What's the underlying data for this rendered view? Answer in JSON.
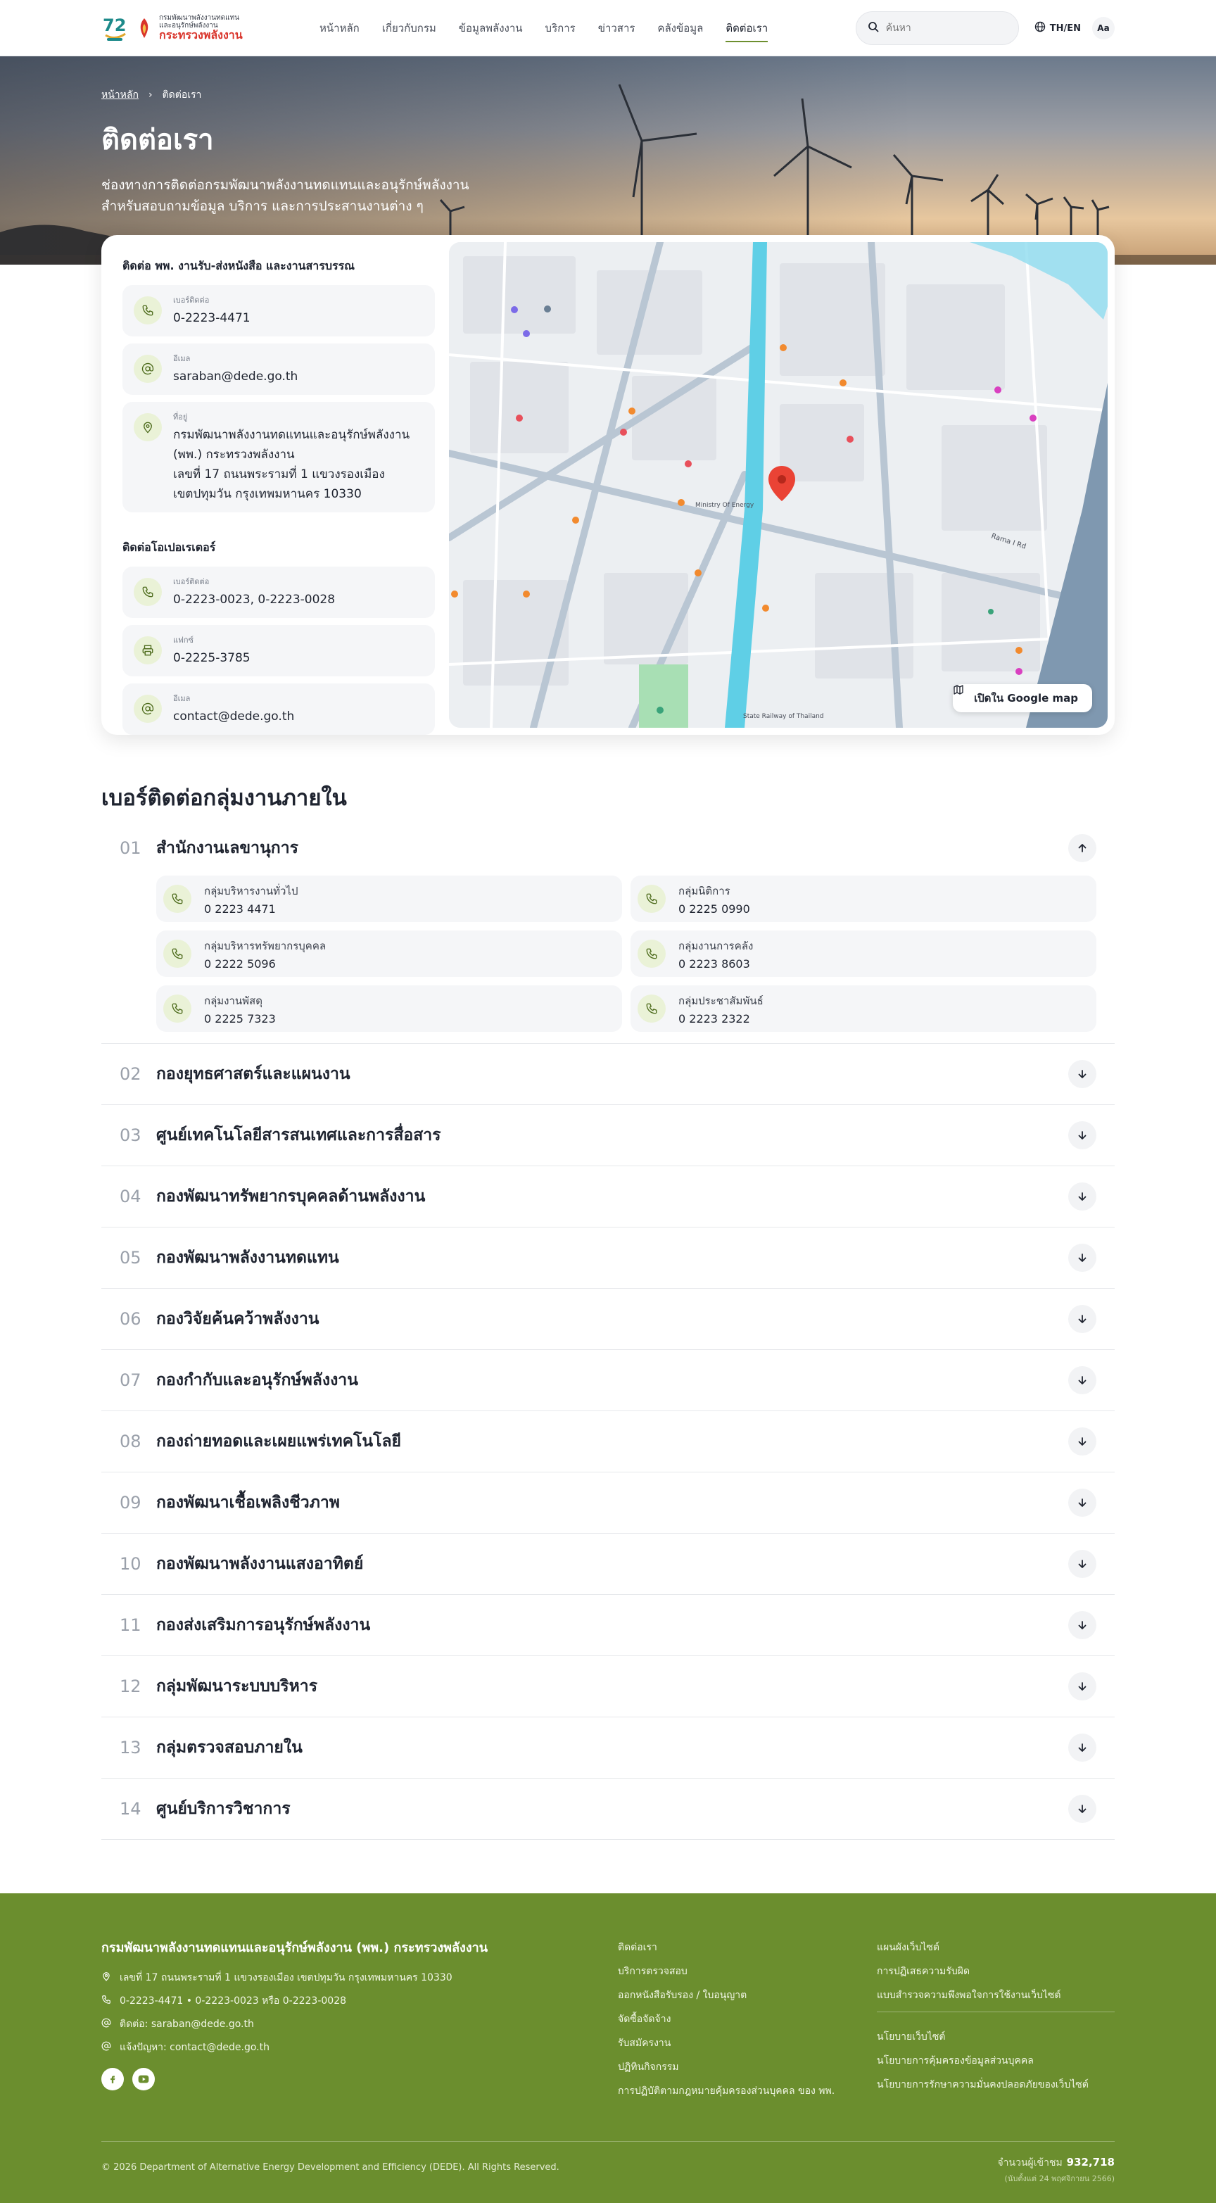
{
  "header": {
    "logo": {
      "line1": "กรมพัฒนาพลังงานทดแทน",
      "line2": "และอนุรักษ์พลังงาน",
      "line3": "กระทรวงพลังงาน",
      "mark_text": "72"
    },
    "nav": [
      {
        "label": "หน้าหลัก"
      },
      {
        "label": "เกี่ยวกับกรม"
      },
      {
        "label": "ข้อมูลพลังงาน"
      },
      {
        "label": "บริการ"
      },
      {
        "label": "ข่าวสาร"
      },
      {
        "label": "คลังข้อมูล"
      },
      {
        "label": "ติดต่อเรา",
        "active": true
      }
    ],
    "search_placeholder": "ค้นหา",
    "lang_label": "TH/EN",
    "font_size_label": "Aa"
  },
  "hero": {
    "breadcrumb_home": "หน้าหลัก",
    "breadcrumb_sep": "›",
    "breadcrumb_current": "ติดต่อเรา",
    "title": "ติดต่อเรา",
    "subtitle_line1": "ช่องทางการติดต่อกรมพัฒนาพลังงานทดแทนและอนุรักษ์พลังงาน",
    "subtitle_line2": "สำหรับสอบถามข้อมูล บริการ และการประสานงานต่าง ๆ"
  },
  "contact": {
    "saraban": {
      "heading": "ติดต่อ พพ. งานรับ-ส่งหนังสือ และงานสารบรรณ",
      "phone_label": "เบอร์ติดต่อ",
      "phone": "0-2223-4471",
      "email_label": "อีเมล",
      "email": "saraban@dede.go.th",
      "address_label": "ที่อยู่",
      "address_lines": [
        "กรมพัฒนาพลังงานทดแทนและอนุรักษ์พลังงาน",
        "(พพ.) กระทรวงพลังงาน",
        "เลขที่ 17 ถนนพระรามที่ 1 แขวงรองเมือง",
        "เขตปทุมวัน กรุงเทพมหานคร 10330"
      ]
    },
    "operator": {
      "heading": "ติดต่อโอเปอเรเตอร์",
      "phone_label": "เบอร์ติดต่อ",
      "phone": "0-2223-0023, 0-2223-0028",
      "fax_label": "แฟกซ์",
      "fax": "0-2225-3785",
      "email_label": "อีเมล",
      "email": "contact@dede.go.th"
    },
    "map": {
      "button_label": "เปิดใน Google map",
      "street_label_1": "Ministry Of Energy",
      "street_label_2": "State Railway of Thailand",
      "street_label_3": "Rama I Rd"
    }
  },
  "departments": {
    "title": "เบอร์ติดต่อกลุ่มงานภายใน",
    "items": [
      {
        "num": "01",
        "name": "สำนักงานเลขานุการ",
        "expanded": true,
        "groups": [
          {
            "name": "กลุ่มบริหารงานทั่วไป",
            "phone": "0 2223 4471"
          },
          {
            "name": "กลุ่มนิติการ",
            "phone": "0 2225 0990"
          },
          {
            "name": "กลุ่มบริหารทรัพยากรบุคคล",
            "phone": "0 2222 5096"
          },
          {
            "name": "กลุ่มงานการคลัง",
            "phone": "0 2223 8603"
          },
          {
            "name": "กลุ่มงานพัสดุ",
            "phone": "0 2225 7323"
          },
          {
            "name": "กลุ่มประชาสัมพันธ์",
            "phone": "0 2223 2322"
          }
        ]
      },
      {
        "num": "02",
        "name": "กองยุทธศาสตร์และแผนงาน"
      },
      {
        "num": "03",
        "name": "ศูนย์เทคโนโลยีสารสนเทศและการสื่อสาร"
      },
      {
        "num": "04",
        "name": "กองพัฒนาทรัพยากรบุคคลด้านพลังงาน"
      },
      {
        "num": "05",
        "name": "กองพัฒนาพลังงานทดแทน"
      },
      {
        "num": "06",
        "name": "กองวิจัยค้นคว้าพลังงาน"
      },
      {
        "num": "07",
        "name": "กองกำกับและอนุรักษ์พลังงาน"
      },
      {
        "num": "08",
        "name": "กองถ่ายทอดและเผยแพร่เทคโนโลยี"
      },
      {
        "num": "09",
        "name": "กองพัฒนาเชื้อเพลิงชีวภาพ"
      },
      {
        "num": "10",
        "name": "กองพัฒนาพลังงานแสงอาทิตย์"
      },
      {
        "num": "11",
        "name": "กองส่งเสริมการอนุรักษ์พลังงาน"
      },
      {
        "num": "12",
        "name": "กลุ่มพัฒนาระบบบริหาร"
      },
      {
        "num": "13",
        "name": "กลุ่มตรวจสอบภายใน"
      },
      {
        "num": "14",
        "name": "ศูนย์บริการวิชาการ"
      }
    ]
  },
  "footer": {
    "org": "กรมพัฒนาพลังงานทดแทนและอนุรักษ์พลังงาน (พพ.) กระทรวงพลังงาน",
    "address": "เลขที่ 17 ถนนพระรามที่ 1 แขวงรองเมือง เขตปทุมวัน กรุงเทพมหานคร 10330",
    "phones": "0-2223-4471 • 0-2223-0023 หรือ 0-2223-0028",
    "email1": "ติดต่อ: saraban@dede.go.th",
    "email2": "แจ้งปัญหา: contact@dede.go.th",
    "col2_links": [
      "ติดต่อเรา",
      "บริการตรวจสอบ",
      "ออกหนังสือรับรอง / ใบอนุญาต",
      "จัดซื้อจัดจ้าง",
      "รับสมัครงาน",
      "ปฏิทินกิจกรรม",
      "การปฏิบัติตามกฎหมายคุ้มครองส่วนบุคคล ของ พพ."
    ],
    "col3_links_a": [
      "แผนผังเว็บไซต์",
      "การปฏิเสธความรับผิด",
      "แบบสำรวจความพึงพอใจการใช้งานเว็บไซต์"
    ],
    "col3_links_b": [
      "นโยบายเว็บไซต์",
      "นโยบายการคุ้มครองข้อมูลส่วนบุคคล",
      "นโยบายการรักษาความมั่นคงปลอดภัยของเว็บไซต์"
    ],
    "copyright": "© 2026 Department of Alternative Energy Development and Efficiency (DEDE). All Rights Reserved.",
    "visitor_label": "จำนวนผู้เข้าชม",
    "visitor_count": "932,718",
    "visitor_date": "(นับตั้งแต่ 24 พฤศจิกายน 2566)",
    "social": [
      "facebook-icon",
      "youtube-icon"
    ]
  },
  "colors": {
    "brand_green": "#6b8e2e",
    "icon_bg": "#eaf2d7",
    "accent_red": "#d9342b",
    "map_water": "#5fcfe6"
  }
}
